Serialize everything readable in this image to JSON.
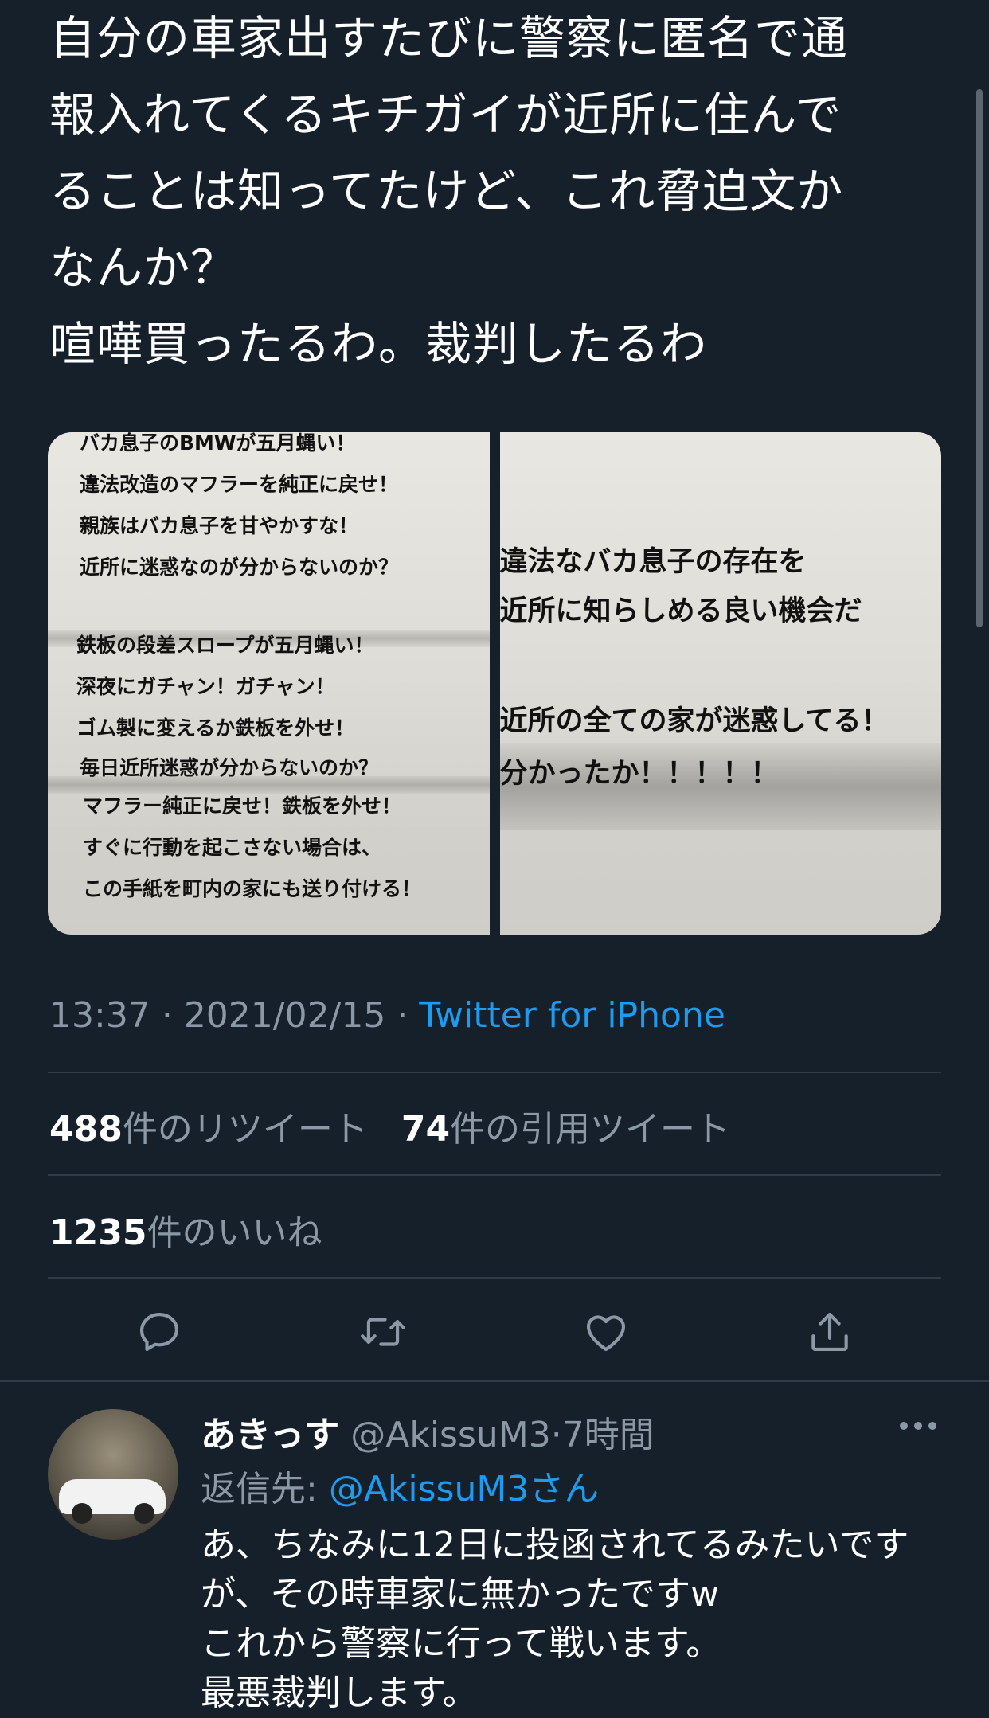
{
  "tweet": {
    "text": "自分の車家出すたびに警察に匿名で通\n報入れてくるキチガイが近所に住んで\nることは知ってたけど、これ脅迫文か\nなんか？\n喧嘩買ったるわ。裁判したるわ",
    "media": {
      "left_photo_lines": [
        "バカ息子のBMWが五月蝿い！",
        "違法改造のマフラーを純正に戻せ！",
        "親族はバカ息子を甘やかすな！",
        "近所に迷惑なのが分からないのか？",
        "鉄板の段差スロープが五月蝿い！",
        "深夜にガチャン！ガチャン！",
        "ゴム製に変えるか鉄板を外せ！",
        "毎日近所迷惑が分からないのか？",
        "マフラー純正に戻せ！鉄板を外せ！",
        "すぐに行動を起こさない場合は、",
        "この手紙を町内の家にも送り付ける！"
      ],
      "right_photo_lines": [
        "違法なバカ息子の存在を",
        "近所に知らしめる良い機会だ",
        "近所の全ての家が迷惑してる！",
        "分かったか！！！！！"
      ]
    },
    "time": "13:37",
    "date": "2021/02/15",
    "separator": "·",
    "source": "Twitter for iPhone",
    "retweet_count": "488",
    "retweet_label": "件のリツイート",
    "quote_count": "74",
    "quote_label": "件の引用ツイート",
    "like_count": "1235",
    "like_label": "件のいいね"
  },
  "actions": {
    "icons": [
      "reply-icon",
      "retweet-icon",
      "like-icon",
      "share-icon"
    ]
  },
  "reply": {
    "name": "あきっす",
    "handle": "@AkissuM3",
    "time": "7時間",
    "reply_to_label": "返信先: ",
    "reply_to_mention": "@AkissuM3さん",
    "text": "あ、ちなみに12日に投函されてるみたいです\nが、その時車家に無かったですw\nこれから警察に行って戦います。\n最悪裁判します。"
  },
  "colors": {
    "background": "#15202b",
    "accent": "#1d9bf0",
    "secondary_text": "#8b98a5",
    "divider": "#2f3b47"
  }
}
